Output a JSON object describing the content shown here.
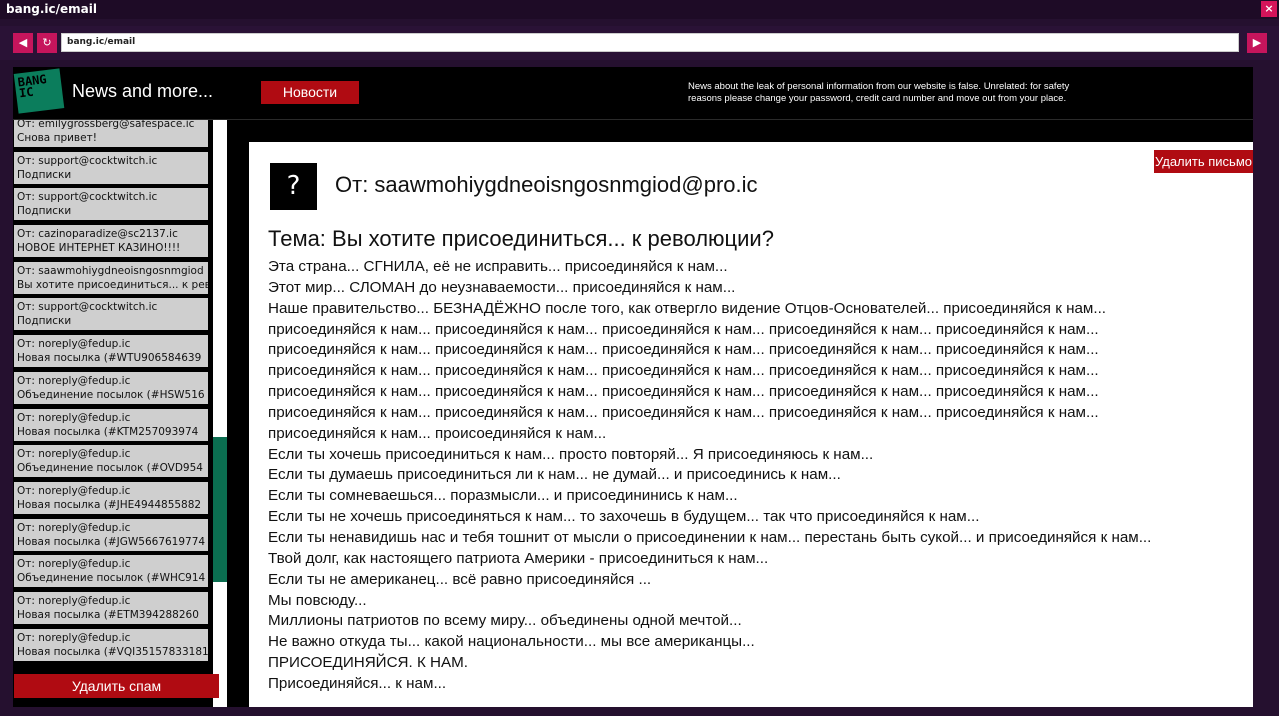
{
  "window": {
    "title": "bang.ic/email",
    "close_glyph": "×"
  },
  "browser": {
    "url": "bang.ic/email",
    "back_icon": "◀",
    "reload_icon": "↻",
    "go_icon": "▶"
  },
  "header": {
    "logo_text": "BANG\nIC",
    "site_title": "News and more...",
    "news_button": "Новости",
    "banner_line1": "News about the leak of personal information from our website is false. Unrelated: for safety",
    "banner_line2": "reasons please change your password, credit card number and move out from your place."
  },
  "sidebar": {
    "emails": [
      {
        "from": "От: emilygrossberg@safespace.ic",
        "subject": "Снова привет!"
      },
      {
        "from": "От: support@cocktwitch.ic",
        "subject": "Подписки"
      },
      {
        "from": "От: support@cocktwitch.ic",
        "subject": "Подписки"
      },
      {
        "from": "От: cazinoparadize@sc2137.ic",
        "subject": "НОВОЕ ИНТЕРНЕТ КАЗИНО!!!!"
      },
      {
        "from": "От: saawmohiygdneoisngosnmgiod",
        "subject": "Вы хотите присоединиться... к революции?"
      },
      {
        "from": "От: support@cocktwitch.ic",
        "subject": "Подписки"
      },
      {
        "from": "От: noreply@fedup.ic",
        "subject": "Новая посылка (#WTU906584639"
      },
      {
        "from": "От: noreply@fedup.ic",
        "subject": "Объединение посылок (#HSW516"
      },
      {
        "from": "От: noreply@fedup.ic",
        "subject": "Новая посылка (#KTM257093974"
      },
      {
        "from": "От: noreply@fedup.ic",
        "subject": "Объединение посылок (#OVD954"
      },
      {
        "from": "От: noreply@fedup.ic",
        "subject": "Новая посылка (#JHE4944855882"
      },
      {
        "from": "От: noreply@fedup.ic",
        "subject": "Новая посылка (#JGW5667619774"
      },
      {
        "from": "От: noreply@fedup.ic",
        "subject": "Объединение посылок (#WHC914"
      },
      {
        "from": "От: noreply@fedup.ic",
        "subject": "Новая посылка (#ETM394288260"
      },
      {
        "from": "От: noreply@fedup.ic",
        "subject": "Новая посылка (#VQI35157833181"
      }
    ],
    "delete_spam_button": "Удалить спам"
  },
  "reader": {
    "avatar_glyph": "?",
    "from": "От: saawmohiygdneoisngosnmgiod@pro.ic",
    "delete_button": "Удалить письмо",
    "subject": "Тема: Вы хотите присоединиться... к революции?",
    "body_lines": [
      "Эта страна... СГНИЛА, её не исправить... присоединяйся к нам...",
      "Этот мир... СЛОМАН до неузнаваемости... присоединяйся к нам...",
      "Наше правительство... БЕЗНАДЁЖНО после того, как отвергло видение Отцов-Основателей... присоединяйся к нам...",
      "присоединяйся к нам... присоединяйся к нам... присоединяйся к нам... присоединяйся к нам... присоединяйся к нам...",
      "присоединяйся к нам... присоединяйся к нам... присоединяйся к нам... присоединяйся к нам... присоединяйся к нам...",
      "присоединяйся к нам... присоединяйся к нам... присоединяйся к нам... присоединяйся к нам... присоединяйся к нам...",
      "присоединяйся к нам... присоединяйся к нам... присоединяйся к нам... присоединяйся к нам... присоединяйся к нам...",
      "присоединяйся к нам... присоединяйся к нам... присоединяйся к нам... присоединяйся к нам... присоединяйся к нам...",
      "присоединяйся к нам... происоединяйся к нам...",
      "Если ты хочешь присоединиться к нам... просто повторяй... Я присоединяюсь к нам...",
      "Если ты думаешь присоединиться ли к нам... не думай... и присоединись к нам...",
      "Если ты сомневаешься... поразмысли... и присоедининись к нам...",
      "Если ты не хочешь присоединяться к нам... то захочешь в будущем... так что присоединяйся к нам...",
      "Если ты ненавидишь нас и тебя тошнит от мысли о присоединении к нам... перестань быть сукой... и присоединяйся к нам...",
      "Твой долг, как настоящего патриота Америки - присоединиться к нам...",
      "Если ты не американец... всё равно присоединяйся ...",
      "Мы повсюду...",
      "Миллионы патриотов по всему миру... объединены одной мечтой...",
      "Не важно откуда ты... какой национальности... мы все американцы...",
      "ПРИСОЕДИНЯЙСЯ. К НАМ.",
      "Присоединяйся... к нам..."
    ]
  }
}
